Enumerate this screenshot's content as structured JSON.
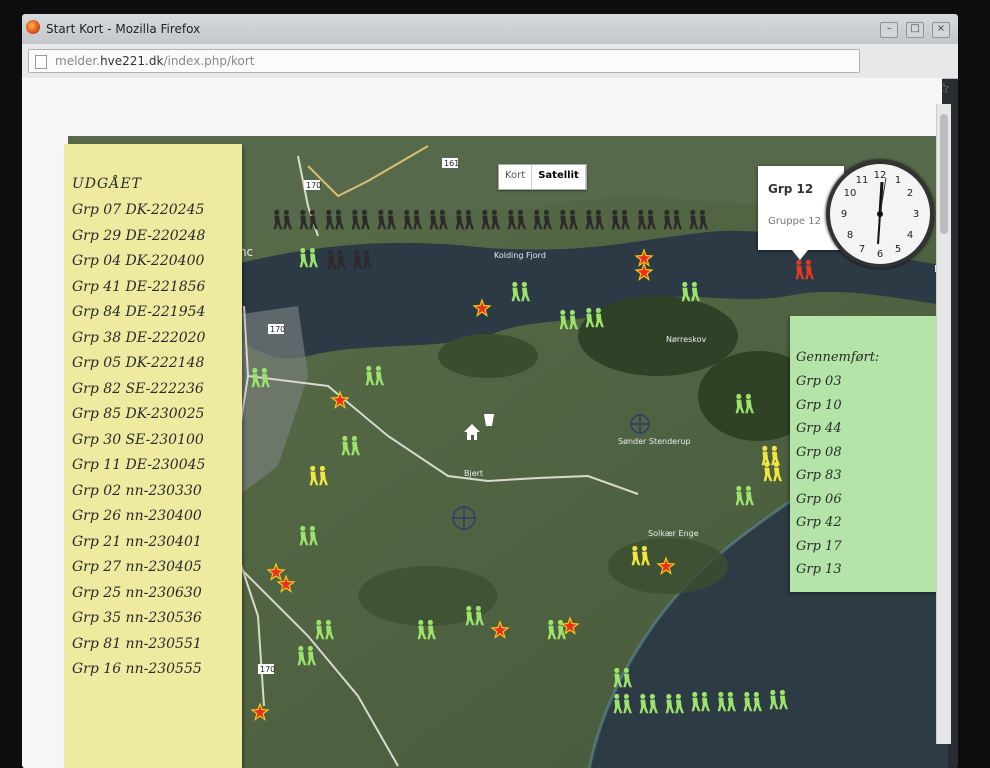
{
  "window": {
    "title": "Start Kort - Mozilla Firefox",
    "url_prefix": "melder.",
    "url_domain": "hve221.dk",
    "url_path": "/index.php/kort",
    "minimize_label": "–",
    "maximize_label": "□",
    "close_label": "×"
  },
  "map": {
    "type_buttons": [
      "Kort",
      "Satellit"
    ],
    "active_type": "Satellit",
    "place_labels": [
      "Kolding Fjord",
      "Nørreskov",
      "Bjert",
      "Sønder Stenderup",
      "Solkær Enge"
    ],
    "road_labels": [
      "161",
      "170",
      "170",
      "170"
    ],
    "city_fragment": "dinc",
    "edge_fragment": "M"
  },
  "infowindow": {
    "title": "Grp 12",
    "subtitle": "Gruppe 12"
  },
  "left_panel": {
    "heading": "UDGÅET",
    "items": [
      "Grp 07 DK-220245",
      "Grp 29 DE-220248",
      "Grp 04 DK-220400",
      "Grp 41 DE-221856",
      "Grp 84 DE-221954",
      "Grp 38 DE-222020",
      "Grp 05 DK-222148",
      "Grp 82 SE-222236",
      "Grp 85 DK-230025",
      "Grp 30 SE-230100",
      "Grp 11 DE-230045",
      "Grp 02 nn-230330",
      "Grp 26 nn-230400",
      "Grp 21 nn-230401",
      "Grp 27 nn-230405",
      "Grp 25 nn-230630",
      "Grp 35 nn-230536",
      "Grp 81 nn-230551",
      "Grp 16 nn-230555"
    ]
  },
  "right_panel": {
    "heading": "Gennemført:",
    "items": [
      "Grp 03",
      "Grp 10",
      "Grp 44",
      "Grp 08",
      "Grp 83",
      "Grp 06",
      "Grp 42",
      "Grp 17",
      "Grp 13"
    ]
  },
  "colors": {
    "left_panel_bg": "#eeeaa0",
    "right_panel_bg": "#b5e4a8",
    "hiker_green": "#9be36a",
    "hiker_yellow": "#f2e640",
    "hiker_red": "#e53a20",
    "hiker_dark": "#2e2a2a",
    "star_red": "#e8321e",
    "star_yellow": "#f5c518"
  },
  "icons": [
    "hikers-icon",
    "star-icon",
    "home-icon",
    "crosshair-icon",
    "clock-icon"
  ]
}
